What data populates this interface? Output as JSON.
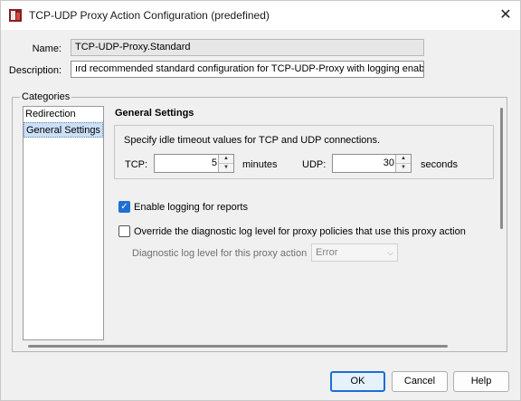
{
  "window": {
    "title": "TCP-UDP Proxy Action Configuration (predefined)",
    "close_glyph": "✕"
  },
  "fields": {
    "name_label": "Name:",
    "name_value": "TCP-UDP-Proxy.Standard",
    "description_label": "Description:",
    "description_value": "ırd recommended standard configuration for TCP-UDP-Proxy with logging enabled"
  },
  "categories": {
    "legend": "Categories",
    "items": [
      {
        "label": "Redirection",
        "selected": false
      },
      {
        "label": "General Settings",
        "selected": true
      }
    ]
  },
  "general": {
    "section_title": "General Settings",
    "timeout_desc": "Specify idle timeout values for TCP and UDP connections.",
    "tcp_label": "TCP:",
    "tcp_value": "5",
    "tcp_unit": "minutes",
    "udp_label": "UDP:",
    "udp_value": "30",
    "udp_unit": "seconds",
    "enable_logging_label": "Enable logging for reports",
    "enable_logging_checked": true,
    "override_label": "Override the diagnostic log level for proxy policies that use this proxy action",
    "override_checked": false,
    "diag_label": "Diagnostic log level for this proxy action",
    "diag_value": "Error"
  },
  "buttons": {
    "ok": "OK",
    "cancel": "Cancel",
    "help": "Help"
  },
  "icons": {
    "app": "watchguard-app-icon",
    "check": "✓",
    "spin_up": "▲",
    "spin_down": "▼",
    "dropdown": "⌵"
  },
  "colors": {
    "accent": "#1f6fd1",
    "selection": "#cbe0f7"
  }
}
